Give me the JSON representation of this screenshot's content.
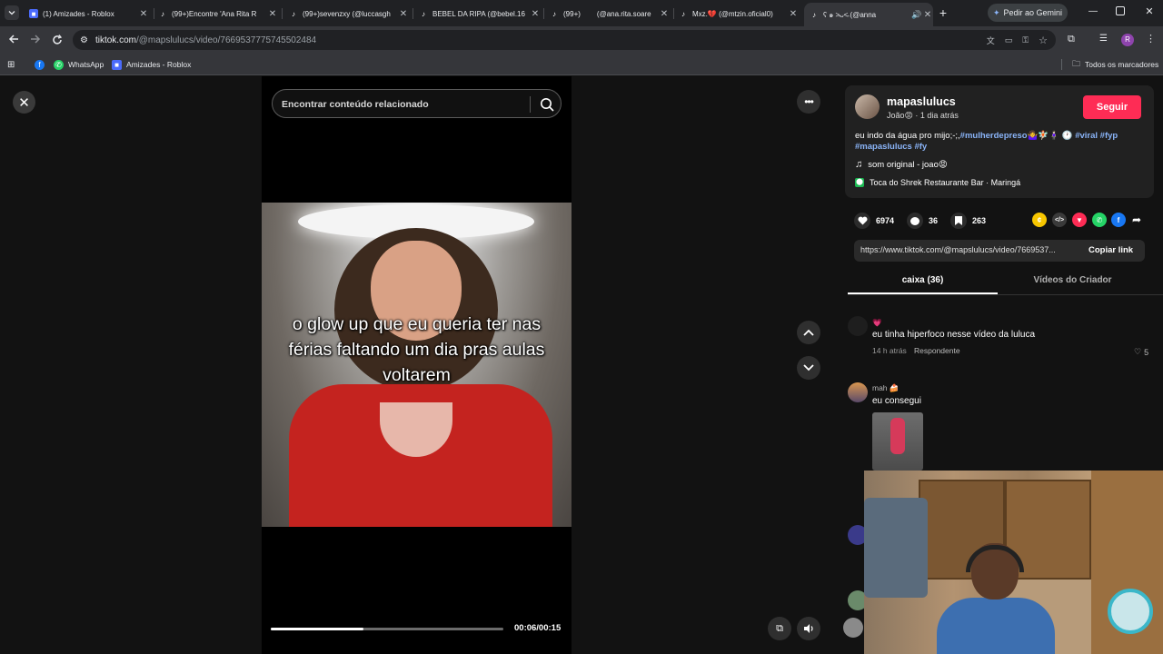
{
  "browser": {
    "tabs": [
      {
        "title": "(1) Amizades - Roblox",
        "icon": "roblox-icon"
      },
      {
        "title": "(99+)Encontre 'Ana Rita R",
        "icon": "tiktok-icon"
      },
      {
        "title": "(99+)sevenzxy (@luccasgh",
        "icon": "tiktok-icon"
      },
      {
        "title": "BEBEL DA RIPA (@bebel.16",
        "icon": "tiktok-icon"
      },
      {
        "title": "(99+)",
        "icon": "tiktok-icon"
      },
      {
        "title": "(@ana.rita.soare",
        "icon": "tiktok-icon"
      },
      {
        "title": "Mxz.💔 (@mtzin.oficial0)",
        "icon": "tiktok-icon"
      },
      {
        "title": "ʕ ๑ ˃̵ᴗ˂̵ (@anna",
        "icon": "tiktok-icon",
        "active": true
      }
    ],
    "gemini_button": "Pedir ao Gemini",
    "url_domain": "tiktok.com",
    "url_path": "/@mapslulucs/video/7669537775745502484",
    "profile_initial": "R",
    "bookmarks": [
      {
        "label": "",
        "icon": "facebook-icon"
      },
      {
        "label": "WhatsApp",
        "icon": "whatsapp-icon"
      },
      {
        "label": "Amizades - Roblox",
        "icon": "roblox-icon"
      }
    ],
    "all_bookmarks": "Todos os marcadores"
  },
  "video": {
    "search_placeholder": "Encontrar conteúdo relacionado",
    "overlay_text": "o glow up que eu queria ter nas férias faltando um dia pras aulas voltarem",
    "progress_fraction": 0.4,
    "time": "00:06/00:15"
  },
  "author": {
    "username": "mapaslulucs",
    "subline": "João😡 · 1 dia atrás",
    "follow_label": "Seguir"
  },
  "caption": {
    "text": "eu indo da água pro mijo;-;,",
    "tags": [
      "#mulherdepreso",
      "#viral",
      "#fyp",
      "#mapaslulucs",
      "#fy"
    ],
    "emojis": "🤷‍♀️🧚🏻🧍🏻‍♀️ 🕐"
  },
  "music": "som original - joao😡",
  "location": "Toca do Shrek Restaurante Bar · Maringá",
  "stats": {
    "likes": "6974",
    "comments": "36",
    "saves": "263"
  },
  "share_colors": {
    "coin": "#f7c600",
    "embed": "#3a3a3a",
    "tiktok": "#fe2c55",
    "whatsapp": "#25d366",
    "facebook": "#1877f2"
  },
  "link": {
    "url": "https://www.tiktok.com/@mapslulucs/video/7669537...",
    "copy_label": "Copiar link"
  },
  "panel_tabs": {
    "comments": "caixa (36)",
    "creator": "Vídeos do Criador"
  },
  "comments": [
    {
      "name": "💗",
      "text": "eu tinha hiperfoco nesse vídeo da luluca",
      "time": "14 h atrás",
      "reply": "Respondente",
      "likes": "5"
    },
    {
      "name": "mah 🍰",
      "text": "eu consegui",
      "has_image": true
    }
  ]
}
